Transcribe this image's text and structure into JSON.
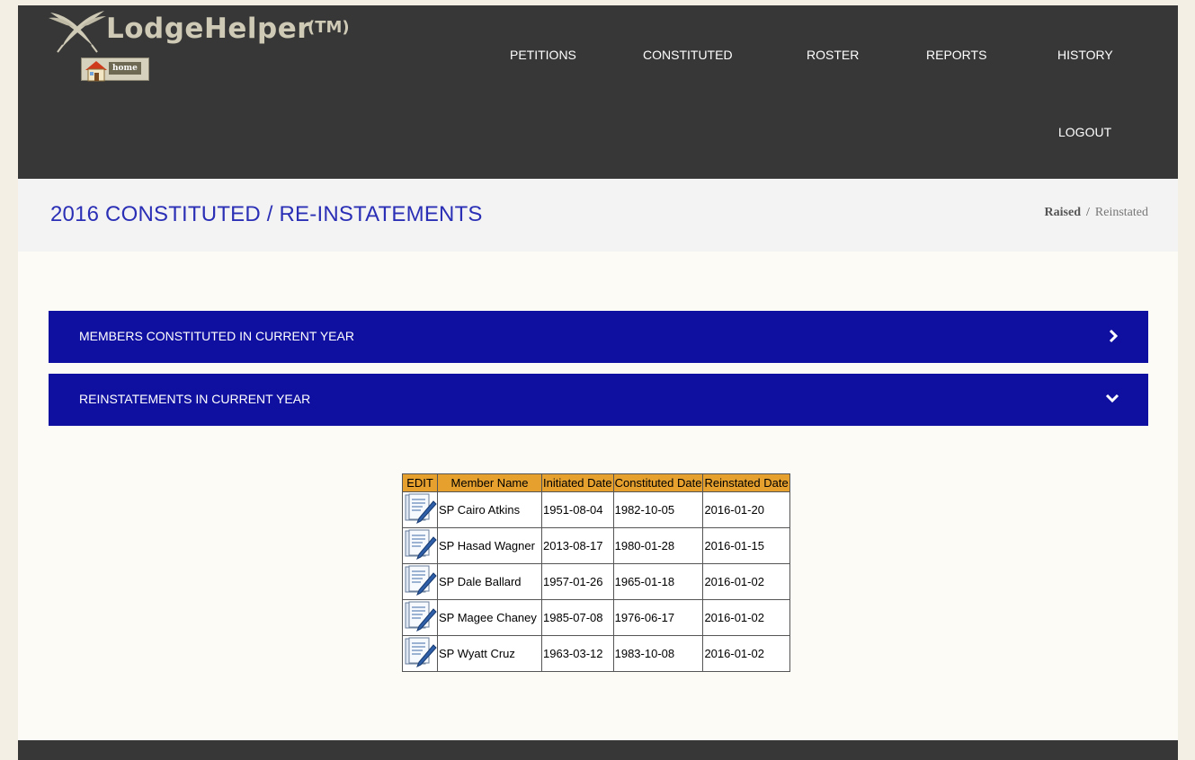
{
  "brand": {
    "name": "LodgeHelper",
    "tm": "(TM)",
    "home_label": "home"
  },
  "nav": [
    {
      "label": "PETITIONS"
    },
    {
      "label": "CONSTITUTED"
    },
    {
      "label": "ROSTER"
    },
    {
      "label": "REPORTS"
    },
    {
      "label": "HISTORY"
    },
    {
      "label": "LOGOUT"
    }
  ],
  "page": {
    "title": "2016 CONSTITUTED / RE-INSTATEMENTS"
  },
  "breadcrumb": {
    "active": "Raised",
    "sep": "/",
    "current": "Reinstated"
  },
  "panels": [
    {
      "title": "MEMBERS CONSTITUTED IN CURRENT YEAR",
      "icon": "chevron-right-icon"
    },
    {
      "title": "REINSTATEMENTS IN CURRENT YEAR",
      "icon": "chevron-down-icon"
    }
  ],
  "table": {
    "headers": [
      "EDIT",
      "Member Name",
      "Initiated Date",
      "Constituted Date",
      "Reinstated Date"
    ],
    "rows": [
      {
        "name": "SP Cairo Atkins",
        "initiated": "1951-08-04",
        "constituted": "1982-10-05",
        "reinstated": "2016-01-20"
      },
      {
        "name": "SP Hasad Wagner",
        "initiated": "2013-08-17",
        "constituted": "1980-01-28",
        "reinstated": "2016-01-15"
      },
      {
        "name": "SP Dale Ballard",
        "initiated": "1957-01-26",
        "constituted": "1965-01-18",
        "reinstated": "2016-01-02"
      },
      {
        "name": "SP Magee Chaney",
        "initiated": "1985-07-08",
        "constituted": "1976-06-17",
        "reinstated": "2016-01-02"
      },
      {
        "name": "SP Wyatt Cruz",
        "initiated": "1963-03-12",
        "constituted": "1983-10-08",
        "reinstated": "2016-01-02"
      }
    ]
  },
  "colors": {
    "header_bg": "#373737",
    "panel_bg": "#1010a0",
    "title_blue": "#2a2fb5",
    "table_header": "#e5a02e"
  }
}
